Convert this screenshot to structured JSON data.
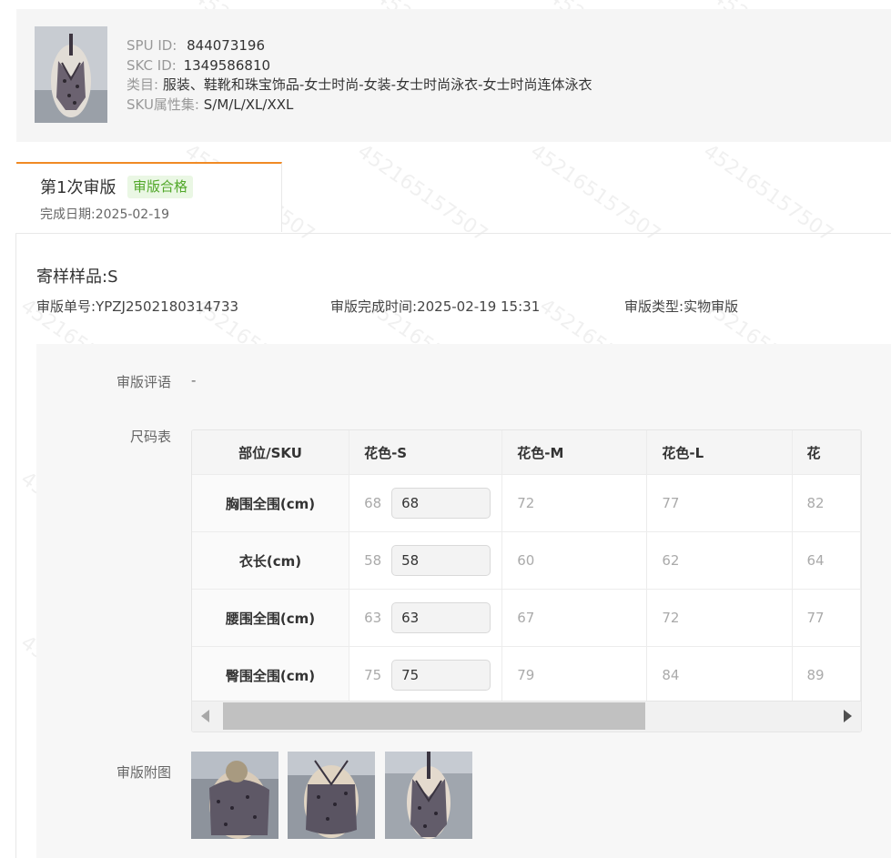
{
  "product": {
    "spu_label": "SPU ID:",
    "spu_value": "844073196",
    "skc_label": "SKC ID:",
    "skc_value": "1349586810",
    "category_label": "类目:",
    "category_value": "服装、鞋靴和珠宝饰品-女士时尚-女装-女士时尚泳衣-女士时尚连体泳衣",
    "sku_attr_label": "SKU属性集:",
    "sku_attr_value": "S/M/L/XL/XXL"
  },
  "review_tab": {
    "title": "第1次审版",
    "badge": "审版合格",
    "date_label": "完成日期:",
    "date_value": "2025-02-19"
  },
  "sample": {
    "title": "寄样样品:S",
    "order_label": "审版单号:",
    "order_value": "YPZJ2502180314733",
    "time_label": "审版完成时间:",
    "time_value": "2025-02-19 15:31",
    "type_label": "审版类型:",
    "type_value": "实物审版"
  },
  "review": {
    "comment_label": "审版评语",
    "comment_value": "-",
    "size_table_label": "尺码表",
    "attachments_label": "审版附图"
  },
  "size_table": {
    "headers": [
      "部位/SKU",
      "花色-S",
      "花色-M",
      "花色-L",
      "花"
    ],
    "rows": [
      {
        "part": "胸围全围(cm)",
        "s_orig": "68",
        "s_input": "68",
        "m": "72",
        "l": "77",
        "xl": "82"
      },
      {
        "part": "衣长(cm)",
        "s_orig": "58",
        "s_input": "58",
        "m": "60",
        "l": "62",
        "xl": "64"
      },
      {
        "part": "腰围全围(cm)",
        "s_orig": "63",
        "s_input": "63",
        "m": "67",
        "l": "72",
        "xl": "77"
      },
      {
        "part": "臀围全围(cm)",
        "s_orig": "75",
        "s_input": "75",
        "m": "79",
        "l": "84",
        "xl": "89"
      }
    ]
  },
  "watermark_text": "452165157507",
  "colors": {
    "accent_orange": "#f08a24",
    "badge_green_text": "#52a82a",
    "badge_green_bg": "#eaf7e4"
  }
}
